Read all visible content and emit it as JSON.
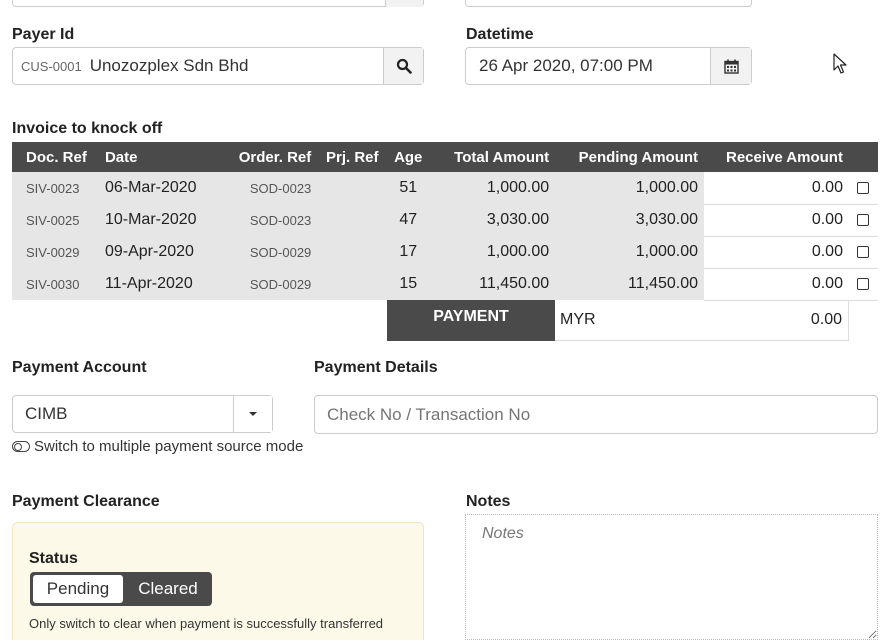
{
  "payer": {
    "label": "Payer Id",
    "code": "CUS-0001",
    "name": "Unozozplex Sdn Bhd"
  },
  "datetime": {
    "label": "Datetime",
    "value": "26 Apr 2020, 07:00 PM"
  },
  "invoices": {
    "title": "Invoice to knock off",
    "headers": [
      "Doc. Ref",
      "Date",
      "Order. Ref",
      "Prj. Ref",
      "Age",
      "Total Amount",
      "Pending Amount",
      "Receive Amount"
    ],
    "rows": [
      {
        "doc": "SIV-0023",
        "date": "06-Mar-2020",
        "order": "SOD-0023",
        "prj": "",
        "age": "51",
        "total": "1,000.00",
        "pending": "1,000.00",
        "receive": "0.00"
      },
      {
        "doc": "SIV-0025",
        "date": "10-Mar-2020",
        "order": "SOD-0023",
        "prj": "",
        "age": "47",
        "total": "3,030.00",
        "pending": "3,030.00",
        "receive": "0.00"
      },
      {
        "doc": "SIV-0029",
        "date": "09-Apr-2020",
        "order": "SOD-0029",
        "prj": "",
        "age": "17",
        "total": "1,000.00",
        "pending": "1,000.00",
        "receive": "0.00"
      },
      {
        "doc": "SIV-0030",
        "date": "11-Apr-2020",
        "order": "SOD-0029",
        "prj": "",
        "age": "15",
        "total": "11,450.00",
        "pending": "11,450.00",
        "receive": "0.00"
      }
    ],
    "payment_label": "PAYMENT",
    "currency": "MYR",
    "payment_total": "0.00"
  },
  "payment_account": {
    "label": "Payment Account",
    "value": "CIMB",
    "switch_text": "Switch to multiple payment source mode"
  },
  "payment_details": {
    "label": "Payment Details",
    "placeholder": "Check No / Transaction No"
  },
  "clearance": {
    "label": "Payment Clearance",
    "status_label": "Status",
    "pending": "Pending",
    "cleared": "Cleared",
    "hint": "Only switch to clear when payment is successfully transferred"
  },
  "notes": {
    "label": "Notes",
    "placeholder": "Notes"
  },
  "colors": {
    "header_bg": "#4a4a4a",
    "row_bg": "#e6e6e6",
    "clearance_bg": "#fdf9e9"
  }
}
